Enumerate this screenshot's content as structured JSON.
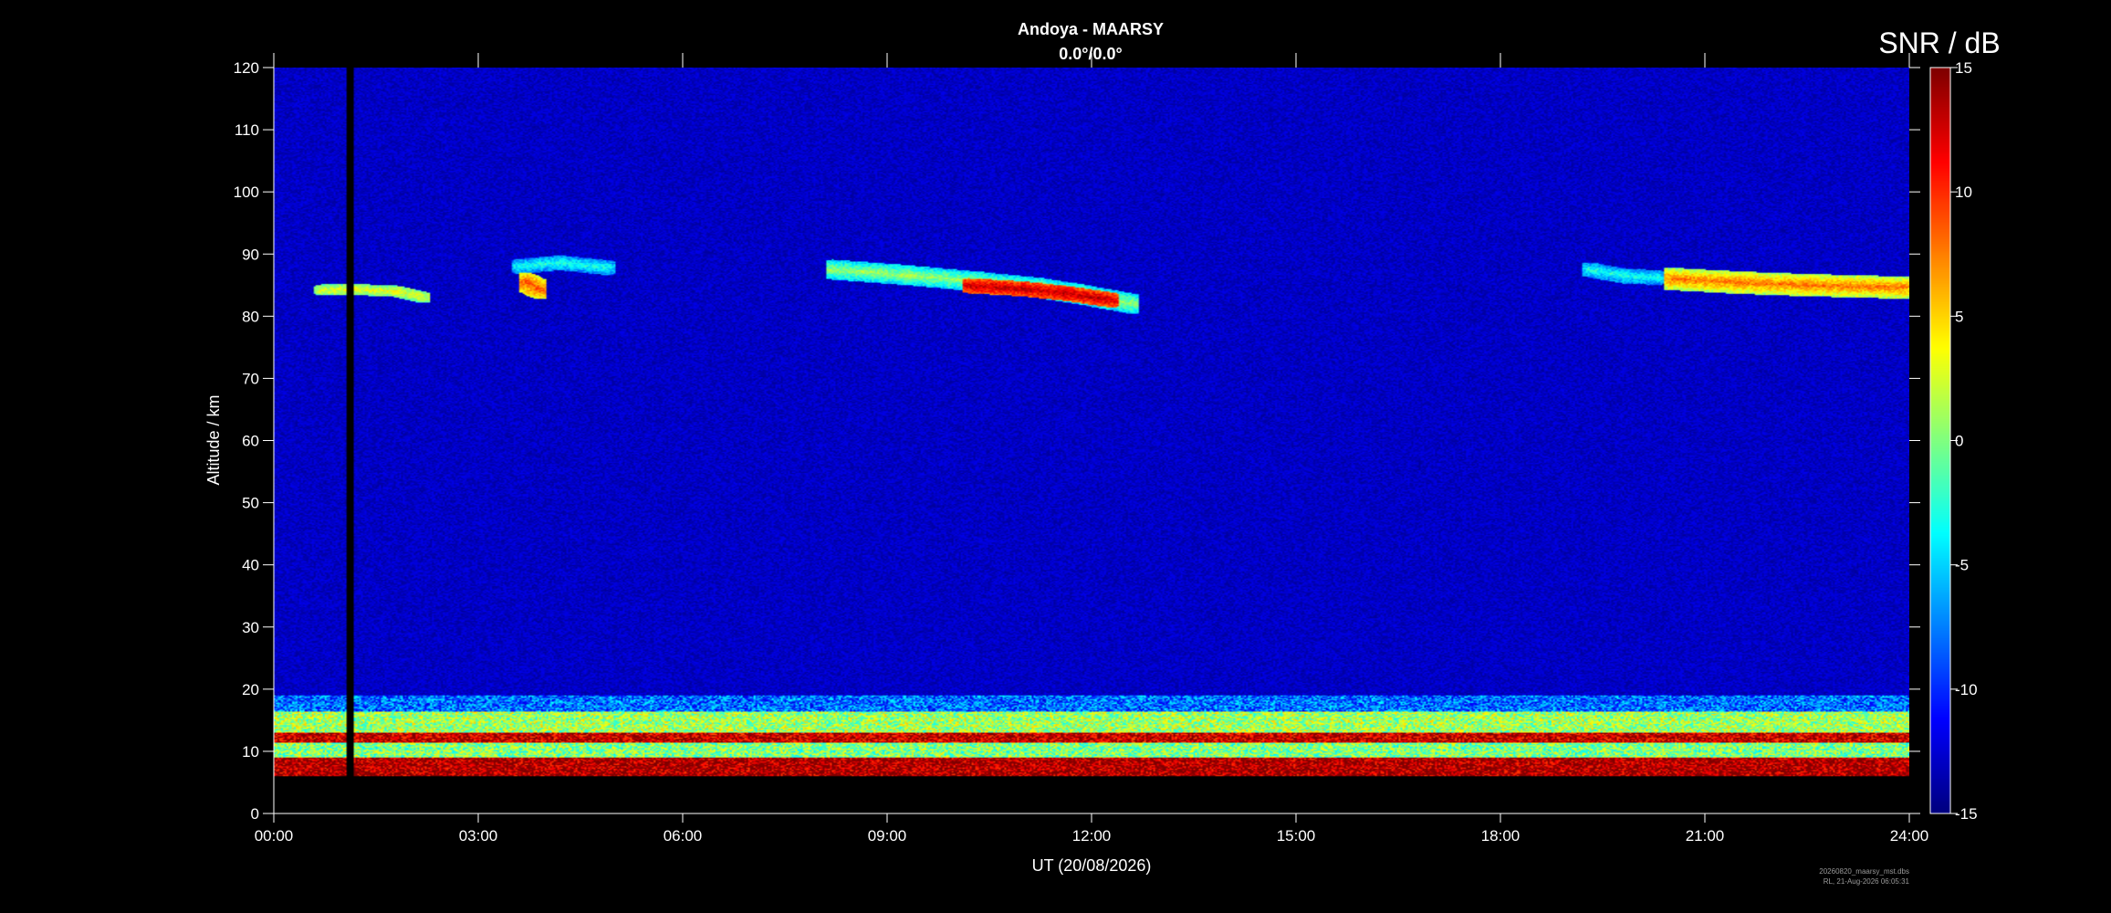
{
  "chart_data": {
    "type": "heatmap",
    "title": "Andoya - MAARSY",
    "subtitle": "0.0°/0.0°",
    "xlabel": "UT (20/08/2026)",
    "ylabel": "Altitude / km",
    "colorbar_label": "SNR / dB",
    "x_ticks": [
      "00:00",
      "03:00",
      "06:00",
      "09:00",
      "12:00",
      "15:00",
      "18:00",
      "21:00",
      "24:00"
    ],
    "xlim_hours": [
      0,
      24
    ],
    "y_ticks": [
      0,
      10,
      20,
      30,
      40,
      50,
      60,
      70,
      80,
      90,
      100,
      110,
      120
    ],
    "ylim": [
      0,
      120
    ],
    "colorbar_ticks": [
      15,
      10,
      5,
      0,
      -5,
      -10,
      -15
    ],
    "clim": [
      -15,
      15
    ],
    "colormap": "jet",
    "background_snr": -13,
    "data_gaps": [
      {
        "hour_start": 1.08,
        "hour_end": 1.16,
        "alt_min": 6,
        "alt_max": 120
      }
    ],
    "no_data_below_km": 6,
    "layers": [
      {
        "name": "troposphere-low",
        "hour_start": 0,
        "hour_end": 24,
        "alt_min": 6,
        "alt_max": 9,
        "snr": 14
      },
      {
        "name": "troposphere-mid",
        "hour_start": 0,
        "hour_end": 24,
        "alt_min": 9,
        "alt_max": 11.5,
        "snr": 0
      },
      {
        "name": "troposphere-peak",
        "hour_start": 0,
        "hour_end": 24,
        "alt_min": 11.5,
        "alt_max": 13,
        "snr": 13
      },
      {
        "name": "troposphere-upper",
        "hour_start": 0,
        "hour_end": 24,
        "alt_min": 13,
        "alt_max": 16.5,
        "snr": 1
      },
      {
        "name": "troposphere-top",
        "hour_start": 0,
        "hour_end": 24,
        "alt_min": 16.5,
        "alt_max": 19,
        "snr": -8
      }
    ],
    "pmse_echoes": [
      {
        "path": [
          [
            0.7,
            84.2
          ],
          [
            1.2,
            84.3
          ],
          [
            1.8,
            84.0
          ],
          [
            2.2,
            83.0
          ]
        ],
        "width_km": 0.9,
        "snr": 3
      },
      {
        "path": [
          [
            3.6,
            88.0
          ],
          [
            4.2,
            88.6
          ],
          [
            4.9,
            87.8
          ]
        ],
        "width_km": 1.2,
        "snr": -3
      },
      {
        "path": [
          [
            3.7,
            85.5
          ],
          [
            3.9,
            84.3
          ]
        ],
        "width_km": 1.5,
        "snr": 9
      },
      {
        "path": [
          [
            8.2,
            87.5
          ],
          [
            9.3,
            86.6
          ],
          [
            10.3,
            85.6
          ],
          [
            11.2,
            84.6
          ],
          [
            11.8,
            83.6
          ],
          [
            12.6,
            82.0
          ]
        ],
        "width_km": 1.6,
        "snr": 1
      },
      {
        "path": [
          [
            10.2,
            84.9
          ],
          [
            11.0,
            84.4
          ],
          [
            11.6,
            83.7
          ],
          [
            12.3,
            82.6
          ]
        ],
        "width_km": 1.2,
        "snr": 13
      },
      {
        "path": [
          [
            19.3,
            87.5
          ],
          [
            19.8,
            86.5
          ],
          [
            20.3,
            86.2
          ]
        ],
        "width_km": 1.2,
        "snr": -3
      },
      {
        "path": [
          [
            20.5,
            86.0
          ],
          [
            21.5,
            85.4
          ],
          [
            22.5,
            85.0
          ],
          [
            23.9,
            84.6
          ]
        ],
        "width_km": 1.8,
        "snr": 8
      }
    ],
    "footer_file": "20260820_maarsy_mst.dbs",
    "footer_stamp": "RL, 21-Aug-2026 06:05:31"
  }
}
